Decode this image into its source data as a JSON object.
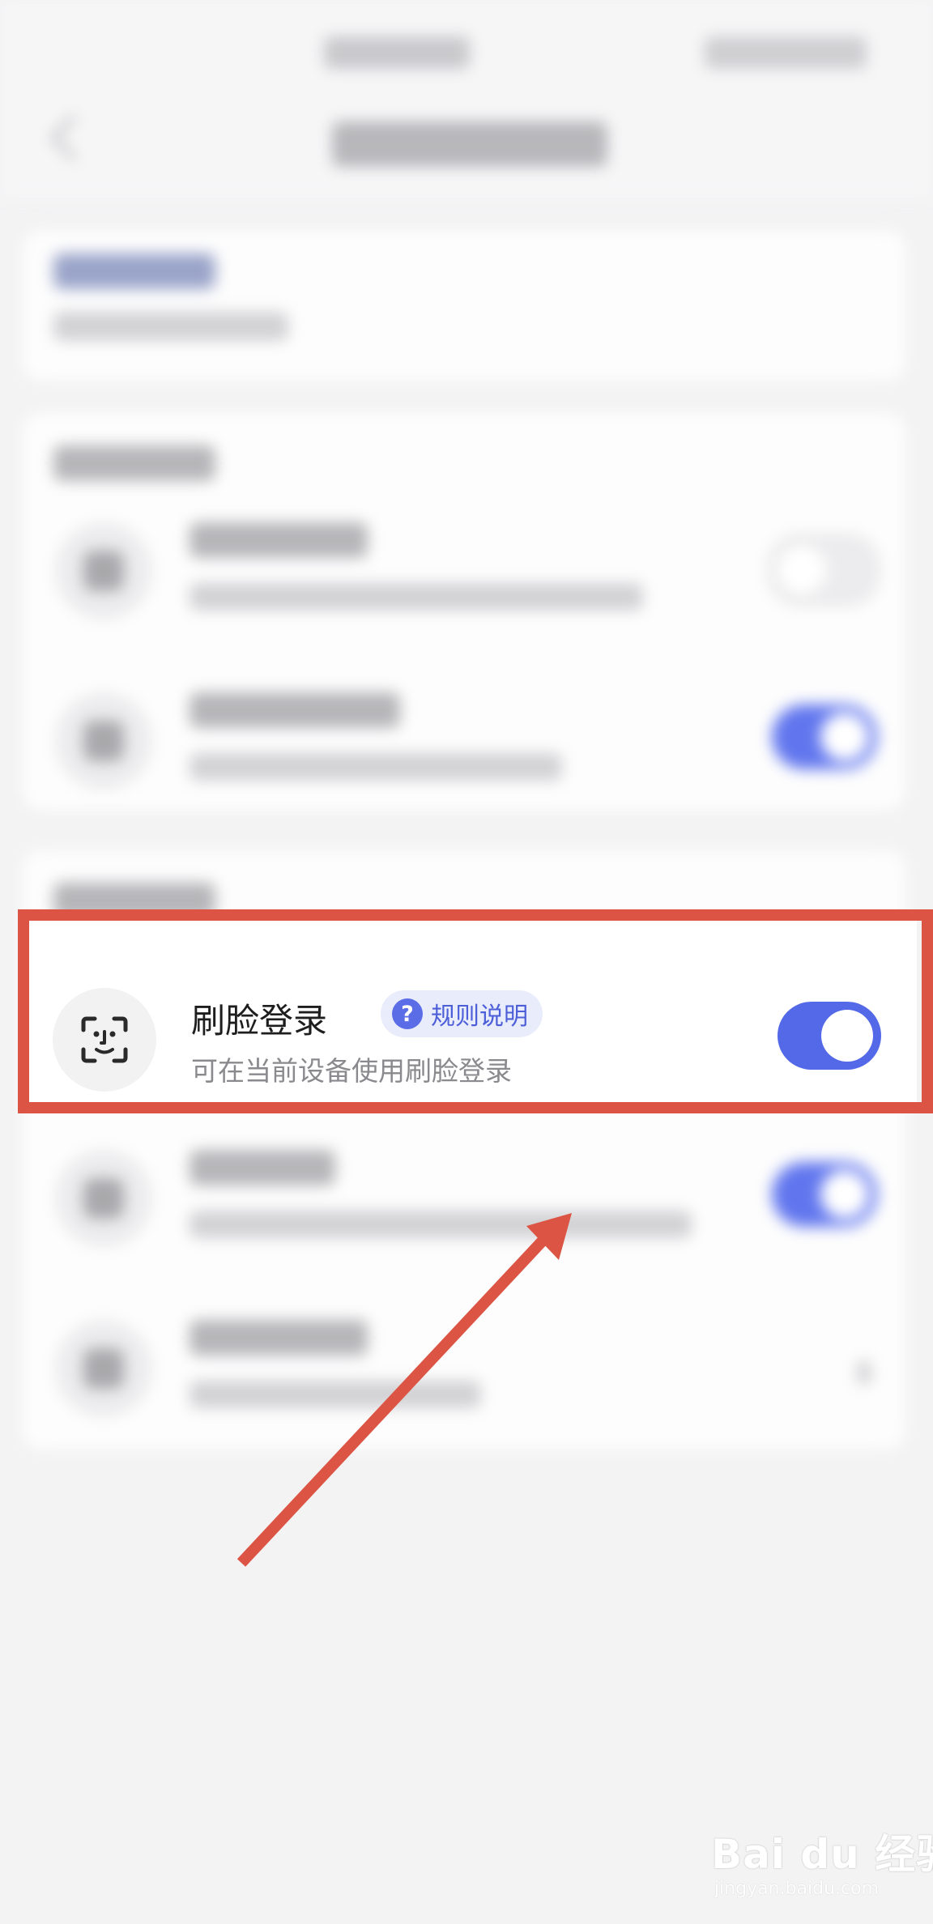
{
  "face_login": {
    "title": "刷脸登录",
    "rule_label": "规则说明",
    "rule_icon": "question-icon",
    "subtitle": "可在当前设备使用刷脸登录",
    "icon": "face-scan-icon",
    "toggle_on": true
  },
  "colors": {
    "accent": "#5469e8",
    "highlight_frame": "#dc5443",
    "arrow": "#dc5443"
  },
  "watermark": {
    "logo": "Bai du 经验",
    "url": "jingyan.baidu.com"
  }
}
